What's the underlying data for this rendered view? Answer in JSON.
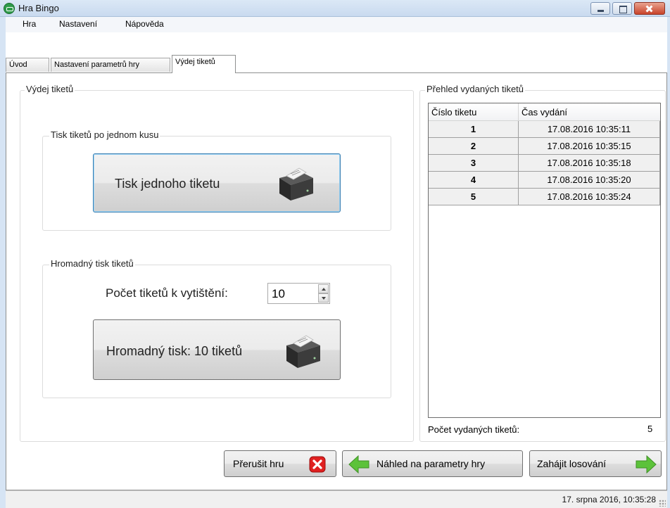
{
  "window": {
    "title": "Hra Bingo"
  },
  "menu": [
    "Hra",
    "Nastavení",
    "Nápověda"
  ],
  "tabs": [
    "Úvod",
    "Nastavení parametrů hry",
    "Výdej tiketů"
  ],
  "left_panel": {
    "title": "Výdej tiketů",
    "single": {
      "group_title": "Tisk tiketů po jednom kusu",
      "button_label": "Tisk jednoho tiketu",
      "icon": "printer-icon"
    },
    "bulk": {
      "group_title": "Hromadný tisk tiketů",
      "count_label": "Počet tiketů k vytištění:",
      "count_value": "10",
      "button_label": "Hromadný tisk: 10 tiketů",
      "icon": "printer-icon"
    }
  },
  "right_panel": {
    "title": "Přehled vydaných tiketů",
    "columns": [
      "Číslo tiketu",
      "Čas vydání"
    ],
    "rows": [
      {
        "number": "1",
        "time": "17.08.2016 10:35:11"
      },
      {
        "number": "2",
        "time": "17.08.2016 10:35:15"
      },
      {
        "number": "3",
        "time": "17.08.2016 10:35:18"
      },
      {
        "number": "4",
        "time": "17.08.2016 10:35:20"
      },
      {
        "number": "5",
        "time": "17.08.2016 10:35:24"
      }
    ],
    "count_label": "Počet vydaných tiketů:",
    "count_value": "5"
  },
  "actions": {
    "abort": {
      "label": "Přerušit hru",
      "icon": "red-x-icon"
    },
    "preview": {
      "label": "Náhled na parametry hry",
      "icon": "green-left-arrow-icon"
    },
    "start": {
      "label": "Zahájit losování",
      "icon": "green-right-arrow-icon"
    }
  },
  "status": {
    "datetime": "17. srpna 2016, 10:35:28"
  },
  "colors": {
    "accent": "#3c7fb1",
    "close": "#c8432a",
    "arrow_green": "#5cc23a",
    "abort_red": "#e02020"
  }
}
